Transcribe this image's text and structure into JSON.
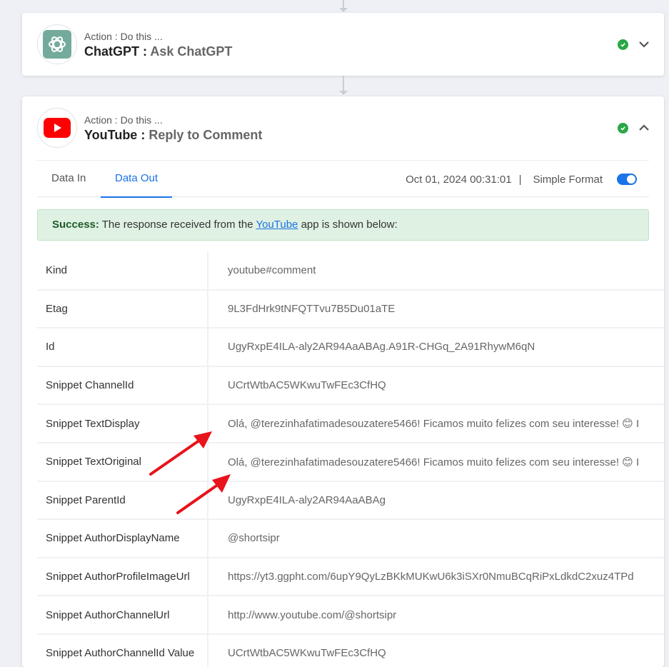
{
  "step1": {
    "action_label": "Action : Do this ...",
    "app": "ChatGPT",
    "sep": " : ",
    "event": "Ask ChatGPT"
  },
  "step2": {
    "action_label": "Action : Do this ...",
    "app": "YouTube",
    "sep": " : ",
    "event": "Reply to Comment",
    "tabs": {
      "in": "Data In",
      "out": "Data Out"
    },
    "date": "Oct 01, 2024 00:31:01",
    "pipe": "|",
    "format_label": "Simple Format",
    "banner": {
      "strong": "Success:",
      "pre": " The response received from the ",
      "link": "YouTube",
      "post": " app is shown below:"
    },
    "rows": [
      {
        "key": "Kind",
        "value": "youtube#comment"
      },
      {
        "key": "Etag",
        "value": "9L3FdHrk9tNFQTTvu7B5Du01aTE"
      },
      {
        "key": "Id",
        "value": "UgyRxpE4ILA-aly2AR94AaABAg.A91R-CHGq_2A91RhywM6qN"
      },
      {
        "key": "Snippet ChannelId",
        "value": "UCrtWtbAC5WKwuTwFEc3CfHQ"
      },
      {
        "key": "Snippet TextDisplay",
        "value": "Olá, @terezinhafatimadesouzatere5466! Ficamos muito felizes com seu interesse! 😊 I"
      },
      {
        "key": "Snippet TextOriginal",
        "value": "Olá, @terezinhafatimadesouzatere5466! Ficamos muito felizes com seu interesse! 😊 I"
      },
      {
        "key": "Snippet ParentId",
        "value": "UgyRxpE4ILA-aly2AR94AaABAg"
      },
      {
        "key": "Snippet AuthorDisplayName",
        "value": "@shortsipr"
      },
      {
        "key": "Snippet AuthorProfileImageUrl",
        "value": "https://yt3.ggpht.com/6upY9QyLzBKkMUKwU6k3iSXr0NmuBCqRiPxLdkdC2xuz4TPd"
      },
      {
        "key": "Snippet AuthorChannelUrl",
        "value": "http://www.youtube.com/@shortsipr"
      },
      {
        "key": "Snippet AuthorChannelId Value",
        "value": "UCrtWtbAC5WKwuTwFEc3CfHQ"
      }
    ]
  },
  "colors": {
    "accent": "#1a73e8",
    "success": "#2aa745",
    "youtube_red": "#ff0000",
    "chatgpt_green": "#74aa9c",
    "annotation_arrow": "#e8131b"
  },
  "icons": [
    "chatgpt-logo-icon",
    "youtube-logo-icon",
    "check-circle-icon",
    "chevron-down-icon",
    "chevron-up-icon",
    "annotation-arrow-icon"
  ]
}
